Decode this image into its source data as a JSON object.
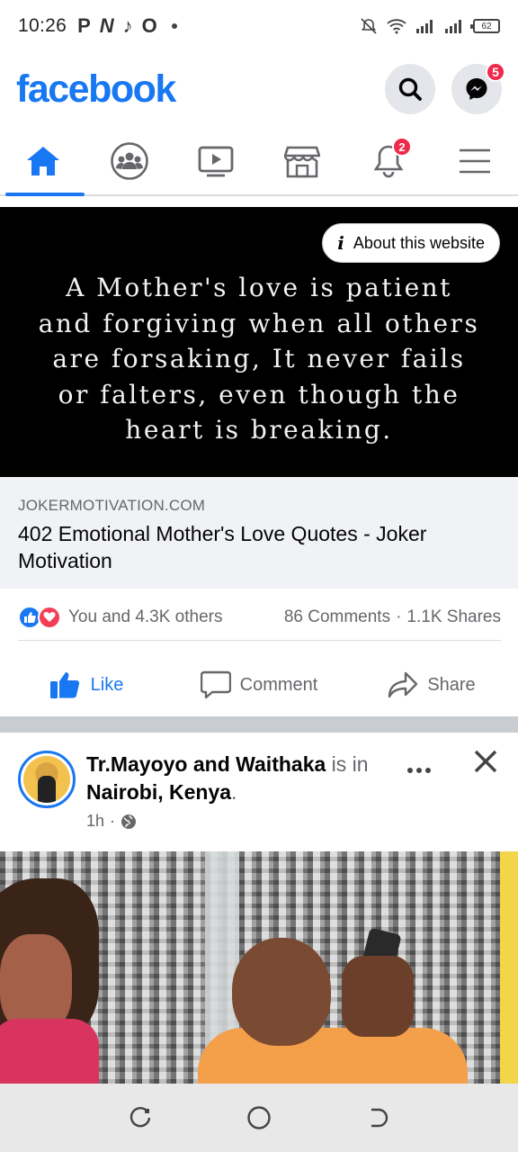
{
  "status_bar": {
    "time": "10:26",
    "apps": [
      "P",
      "N",
      "♪",
      "O"
    ],
    "battery": "62"
  },
  "header": {
    "logo": "facebook",
    "messenger_badge": "5"
  },
  "tabs": {
    "notifications_badge": "2"
  },
  "link_post": {
    "about_website_label": "About this website",
    "quote_lines": [
      "A Mother's love is patient",
      "and forgiving when all others",
      "are forsaking, It never fails",
      "or falters, even though the",
      "heart is breaking."
    ],
    "domain": "JOKERMOTIVATION.COM",
    "title": "402 Emotional Mother's Love Quotes - Joker Motivation",
    "reactions_text": "You and 4.3K others",
    "comments": "86 Comments",
    "shares": "1.1K Shares",
    "like_label": "Like",
    "comment_label": "Comment",
    "share_label": "Share"
  },
  "post2": {
    "author": "Tr.Mayoyo and Waithaka",
    "is_in": "is in",
    "location": "Nairobi, Kenya",
    "time": "1h"
  },
  "colors": {
    "brand": "#1877f2",
    "badge": "#f02849",
    "love": "#f33e58"
  }
}
